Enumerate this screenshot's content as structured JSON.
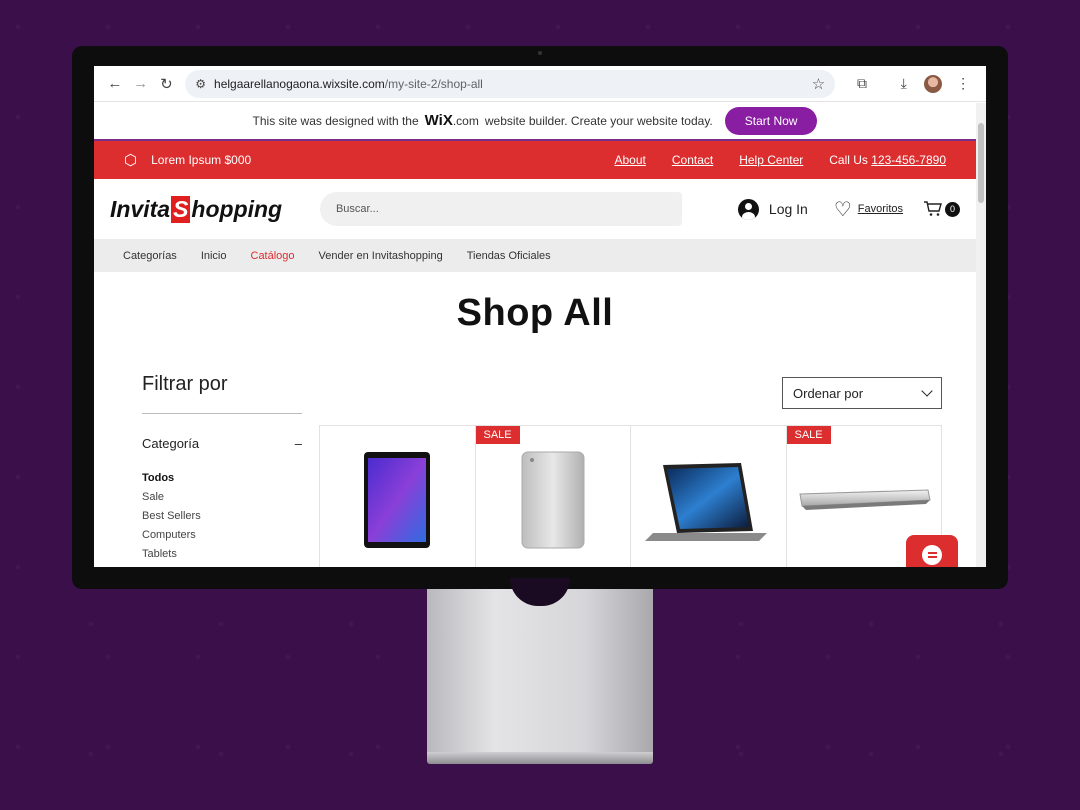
{
  "browser": {
    "url_host": "helgaarellanogaona.wixsite.com",
    "url_path": "/my-site-2/shop-all",
    "icons": [
      "back-icon",
      "forward-icon",
      "reload-icon",
      "site-info-icon",
      "bookmark-star-icon",
      "extensions-icon",
      "download-icon",
      "profile-avatar",
      "menu-kebab-icon"
    ]
  },
  "wix_banner": {
    "text_before": "This site was designed with the",
    "logo": "WiX",
    "logo_suffix": ".com",
    "text_after": "website builder. Create your website today.",
    "button": "Start Now"
  },
  "top_bar": {
    "promo": "Lorem Ipsum $000",
    "links": [
      "About",
      "Contact",
      "Help Center"
    ],
    "call_label": "Call Us",
    "phone": "123-456-7890"
  },
  "header": {
    "logo_a": "Invita",
    "logo_s": "S",
    "logo_b": "hopping",
    "search_placeholder": "Buscar...",
    "login": "Log In",
    "favorites": "Favoritos",
    "cart_count": "0"
  },
  "category_nav": {
    "items": [
      "Categorías",
      "Inicio",
      "Catálogo",
      "Vender en Invitashopping",
      "Tiendas Oficiales"
    ],
    "active_index": 2
  },
  "main": {
    "title": "Shop All",
    "filter_title": "Filtrar por",
    "category_heading": "Categoría",
    "collapse_symbol": "–",
    "categories": [
      "Todos",
      "Sale",
      "Best Sellers",
      "Computers",
      "Tablets"
    ],
    "sort_label": "Ordenar por"
  },
  "products": [
    {
      "badge": "",
      "image": "tablet-black-front"
    },
    {
      "badge": "SALE",
      "image": "tablet-silver-back"
    },
    {
      "badge": "",
      "image": "tablet-with-keyboard-case"
    },
    {
      "badge": "SALE",
      "image": "tablet-silver-flat"
    }
  ],
  "colors": {
    "background": "#3a0f4a",
    "accent_red": "#dc2d2f",
    "wix_purple": "#8a1ea3"
  }
}
